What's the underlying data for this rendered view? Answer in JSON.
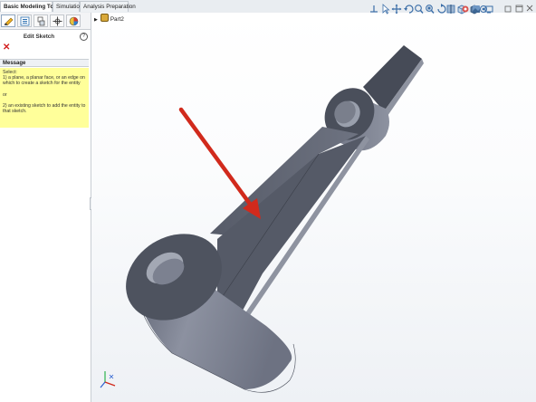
{
  "tabs": {
    "basic": "Basic Modeling Tools",
    "simulation": "Simulation",
    "analysis": "Analysis Preparation"
  },
  "panel": {
    "title": "Edit Sketch",
    "help": "?",
    "close": "✕",
    "message_header": "Message",
    "message": {
      "line_select": "Select:",
      "line_1": "1) a plane, a planar face, or an edge on which to create a sketch for the entity",
      "line_or": "or",
      "line_2": "2) an existing sketch to add the entity to that sketch."
    }
  },
  "tree": {
    "part": "Part2"
  },
  "icons": {
    "panel_tabs": [
      "property-manager-icon",
      "feature-manager-icon",
      "configuration-manager-icon",
      "dimxpert-icon",
      "display-manager-icon"
    ],
    "hud": [
      "move-triad-icon",
      "select-icon",
      "pan-icon",
      "rotate-icon",
      "zoom-icon",
      "zoom-fit-icon",
      "previous-view-icon",
      "section-view-icon",
      "view-orientation-icon",
      "display-style-icon",
      "hide-show-icon",
      "appearance-icon",
      "scene-icon",
      "view-settings-icon"
    ]
  },
  "colors": {
    "part_face_dark": "#4a4f5b",
    "part_face_light": "#8e93a0",
    "arrow": "#d12a1c",
    "message_bg": "#ffff9a"
  }
}
